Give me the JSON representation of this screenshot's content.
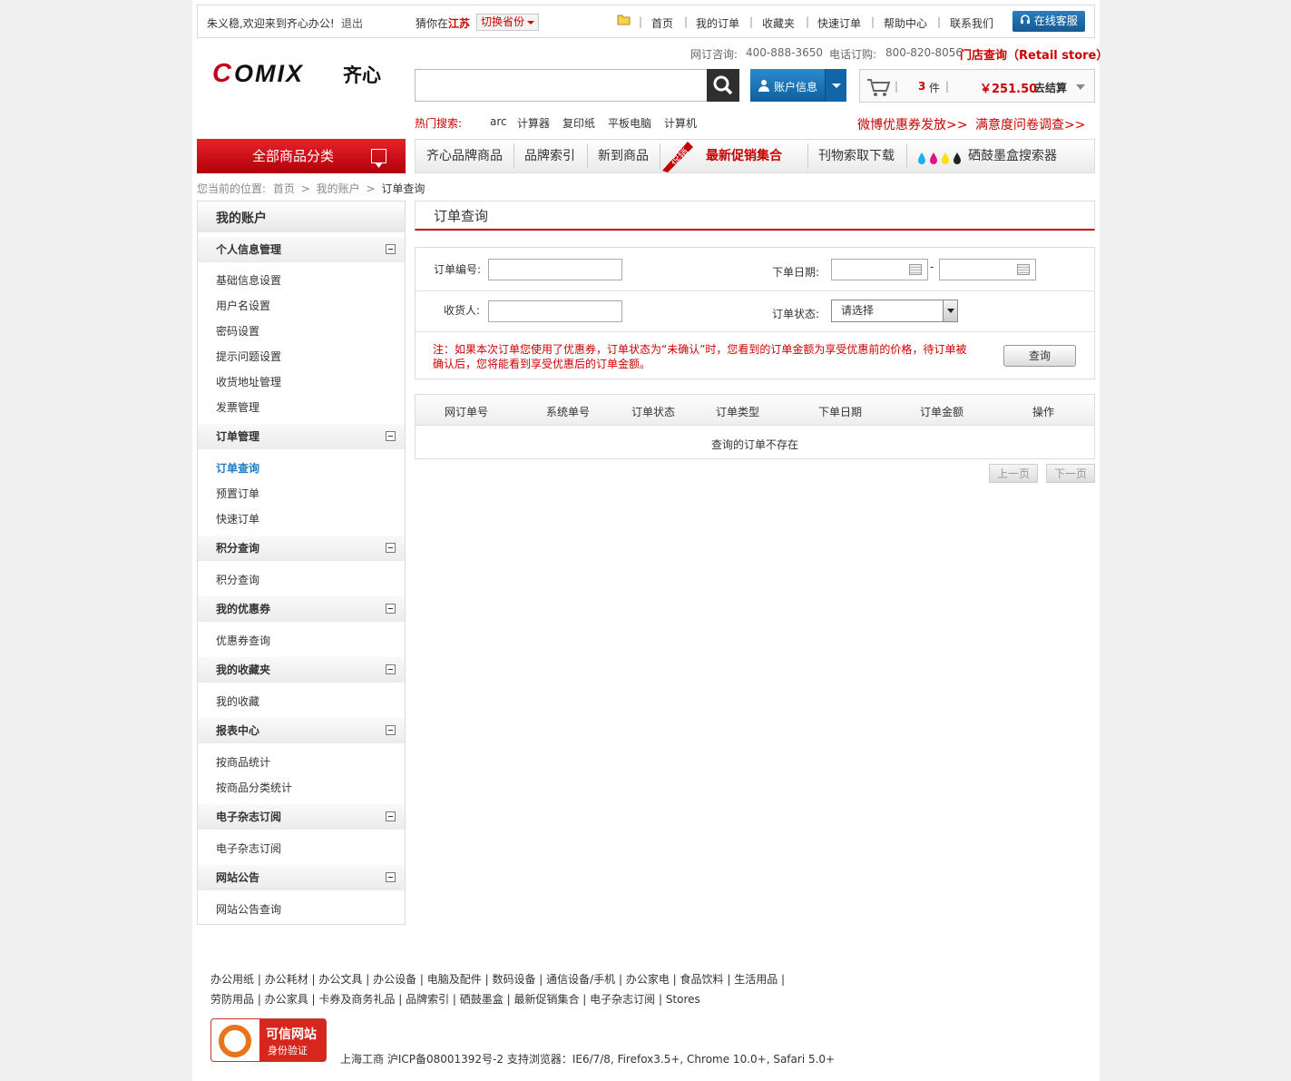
{
  "topbar": {
    "welcome": "朱义稳,欢迎来到齐心办公!",
    "logout": "退出",
    "guess_prefix": "猜你在",
    "province": "江苏",
    "switch_province": "切换省份",
    "links": [
      "首页",
      "我的订单",
      "收藏夹",
      "快速订单",
      "帮助中心",
      "联系我们"
    ],
    "online_service": "在线客服"
  },
  "header": {
    "logo_text": "COMIX",
    "logo_cn": "齐心",
    "hotline_label": "网订咨询:",
    "hotline": "400-888-3650",
    "phone_label": "电话订购:",
    "phone": "800-820-8056",
    "store_query": "门店查询（Retail store）",
    "account_label": "账户信息",
    "cart_count": "3",
    "cart_unit": "件",
    "cart_total": "￥251.50",
    "checkout": "去结算",
    "hot_label": "热门搜索:",
    "hot_terms": [
      "arc",
      "计算器",
      "复印纸",
      "平板电脑",
      "计算机"
    ],
    "promo1": "微博优惠券发放>>",
    "promo2": "满意度问卷调查>>"
  },
  "nav": {
    "all_categories": "全部商品分类",
    "items": [
      "齐心品牌商品",
      "品牌索引",
      "新到商品",
      "最新促销集合",
      "刊物索取下载",
      "硒鼓墨盒搜索器"
    ],
    "promo_tag": "促销"
  },
  "breadcrumb": {
    "prefix": "您当前的位置:",
    "items": [
      "首页",
      "我的账户",
      "订单查询"
    ]
  },
  "sidebar": {
    "title": "我的账户",
    "sections": [
      {
        "title": "个人信息管理",
        "items": [
          "基础信息设置",
          "用户名设置",
          "密码设置",
          "提示问题设置",
          "收货地址管理",
          "发票管理"
        ]
      },
      {
        "title": "订单管理",
        "items": [
          "订单查询",
          "预置订单",
          "快速订单"
        ]
      },
      {
        "title": "积分查询",
        "items": [
          "积分查询"
        ]
      },
      {
        "title": "我的优惠券",
        "items": [
          "优惠券查询"
        ]
      },
      {
        "title": "我的收藏夹",
        "items": [
          "我的收藏"
        ]
      },
      {
        "title": "报表中心",
        "items": [
          "按商品统计",
          "按商品分类统计"
        ]
      },
      {
        "title": "电子杂志订阅",
        "items": [
          "电子杂志订阅"
        ]
      },
      {
        "title": "网站公告",
        "items": [
          "网站公告查询"
        ]
      }
    ]
  },
  "main": {
    "title": "订单查询",
    "order_no_label": "订单编号:",
    "order_date_label": "下单日期:",
    "date_sep": "-",
    "receiver_label": "收货人:",
    "status_label": "订单状态:",
    "status_selected": "请选择",
    "note": "注：如果本次订单您使用了优惠券，订单状态为“未确认”时，您看到的订单金额为享受优惠前的价格，待订单被确认后，您将能看到享受优惠后的订单金额。",
    "query_button": "查询",
    "columns": [
      "网订单号",
      "系统单号",
      "订单状态",
      "订单类型",
      "下单日期",
      "订单金额",
      "操作"
    ],
    "empty": "查询的订单不存在",
    "prev": "上一页",
    "next": "下一页"
  },
  "footer": {
    "links": [
      "办公用纸",
      "办公耗材",
      "办公文具",
      "办公设备",
      "电脑及配件",
      "数码设备",
      "通信设备/手机",
      "办公家电",
      "食品饮料",
      "生活用品",
      "劳防用品",
      "办公家具",
      "卡券及商务礼品",
      "品牌索引",
      "硒鼓墨盒",
      "最新促销集合",
      "电子杂志订阅",
      "Stores"
    ],
    "badge_line1": "可信网站",
    "badge_line2": "身份验证",
    "info": "上海工商   沪ICP备08001392号-2  支持浏览器：IE6/7/8, Firefox3.5+, Chrome 10.0+, Safari 5.0+"
  },
  "colors": {
    "accent_red": "#c40000",
    "brand_blue": "#1c7dc6"
  }
}
